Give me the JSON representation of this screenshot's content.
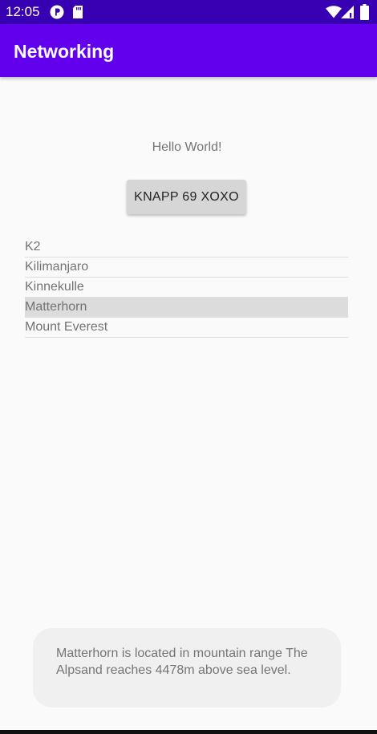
{
  "status_bar": {
    "time": "12:05",
    "color": "#3700b3",
    "icons": [
      "p-icon",
      "sd-card-icon",
      "wifi-icon",
      "signal-icon",
      "battery-icon"
    ]
  },
  "app_bar": {
    "title": "Networking",
    "color": "#6200ee"
  },
  "main": {
    "hello_text": "Hello World!",
    "button_label": "KNAPP 69 XOXO"
  },
  "mountains": {
    "items": [
      {
        "label": "K2",
        "selected": false
      },
      {
        "label": "Kilimanjaro",
        "selected": false
      },
      {
        "label": "Kinnekulle",
        "selected": false
      },
      {
        "label": "Matterhorn",
        "selected": true
      },
      {
        "label": "Mount Everest",
        "selected": false
      }
    ]
  },
  "toast": {
    "message": "Matterhorn is located in mountain range The Alpsand reaches 4478m above sea level."
  }
}
